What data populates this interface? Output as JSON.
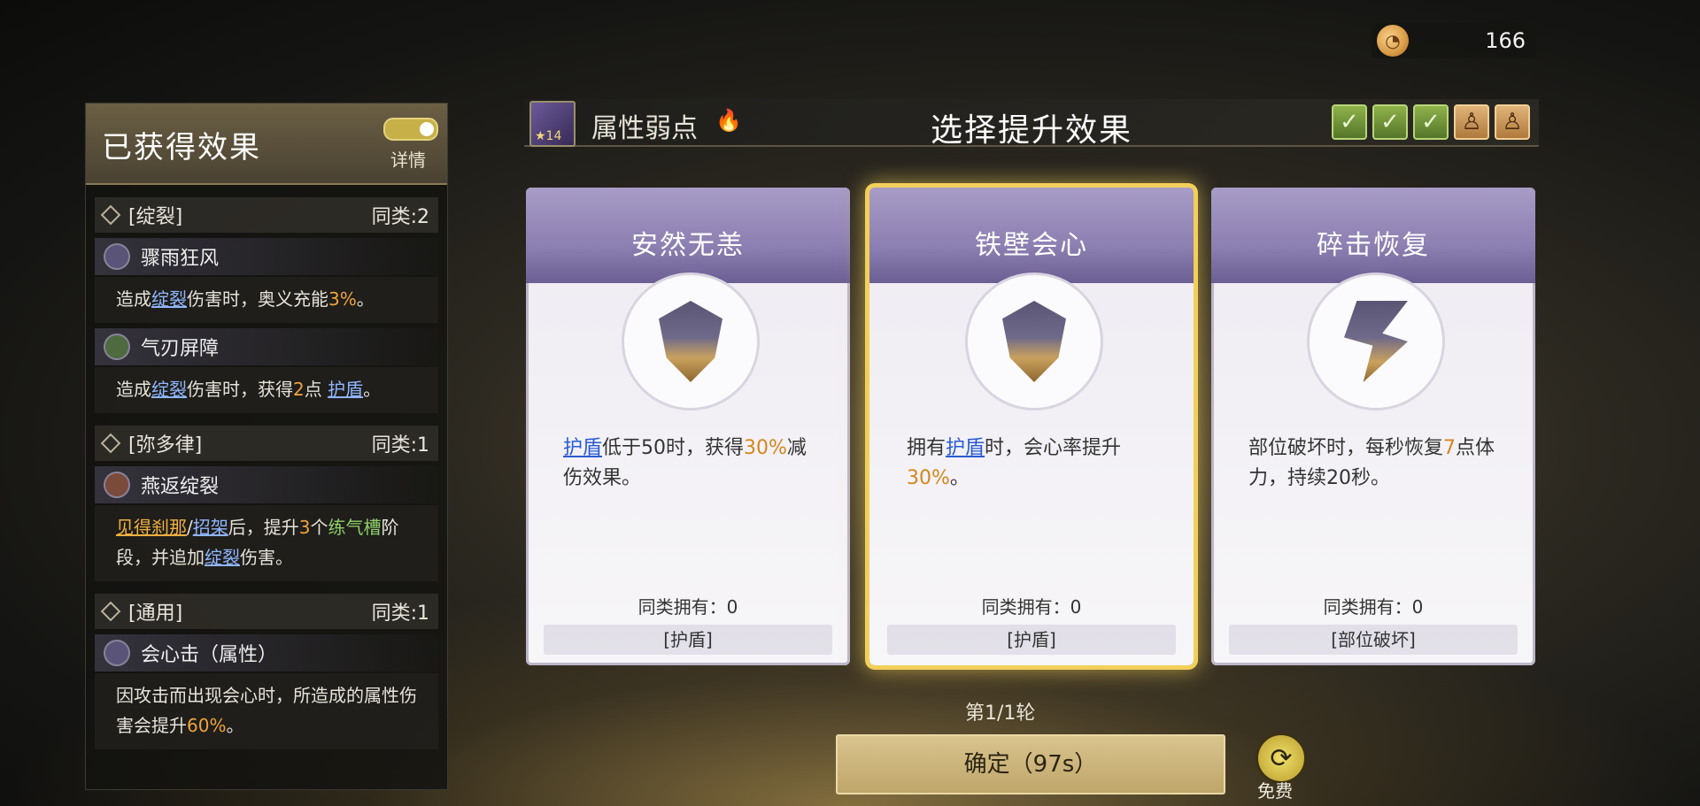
{
  "currency": {
    "icon": "peach-coin-icon",
    "value": "166"
  },
  "left_panel": {
    "title": "已获得效果",
    "toggle_label": "详情",
    "groups": [
      {
        "name": "[绽裂]",
        "count": "同类:2",
        "skills": [
          {
            "name": "骤雨狂风",
            "desc": [
              "造成",
              "绽裂",
              "伤害时，奥义充能",
              "3%",
              "。"
            ]
          },
          {
            "name": "气刃屏障",
            "desc": [
              "造成",
              "绽裂",
              "伤害时，获得",
              "2",
              "点 ",
              "护盾",
              "。"
            ]
          }
        ]
      },
      {
        "name": "[弥多律]",
        "count": "同类:1",
        "skills": [
          {
            "name": "燕返绽裂",
            "desc": [
              "见得刹那",
              "/",
              "招架",
              "后，提升",
              "3",
              "个",
              "练气槽",
              "阶段，并追加",
              "绽裂",
              "伤害。"
            ]
          }
        ]
      },
      {
        "name": "[通用]",
        "count": "同类:1",
        "skills": [
          {
            "name": "会心击（属性）",
            "desc": [
              "因攻击而出现会心时，所造成的属性伤害会提升",
              "60%",
              "。"
            ]
          }
        ]
      }
    ]
  },
  "header": {
    "weakness_label": "属性弱点",
    "weakness_level": "★14",
    "title": "选择提升效果",
    "progress": [
      "done",
      "done",
      "done",
      "locked",
      "locked"
    ]
  },
  "cards": [
    {
      "title": "安然无恙",
      "icon": "shield-emblem-icon",
      "desc": [
        "护盾",
        "低于50时，获得",
        "30%",
        "减伤效果。"
      ],
      "count": "同类拥有：0",
      "tag": "[护盾]",
      "selected": false
    },
    {
      "title": "铁壁会心",
      "icon": "shield-emblem-icon",
      "desc": [
        "拥有",
        "护盾",
        "时，会心率提升",
        "30%",
        "。"
      ],
      "count": "同类拥有：0",
      "tag": "[护盾]",
      "selected": true
    },
    {
      "title": "碎击恢复",
      "icon": "strike-emblem-icon",
      "desc": [
        "部位破坏时，每秒恢复",
        "7",
        "点体力，持续20秒。"
      ],
      "count": "同类拥有：0",
      "tag": "[部位破坏]",
      "selected": false
    }
  ],
  "footer": {
    "round": "第1/1轮",
    "confirm": "确定（97s）",
    "free_label": "免费"
  }
}
